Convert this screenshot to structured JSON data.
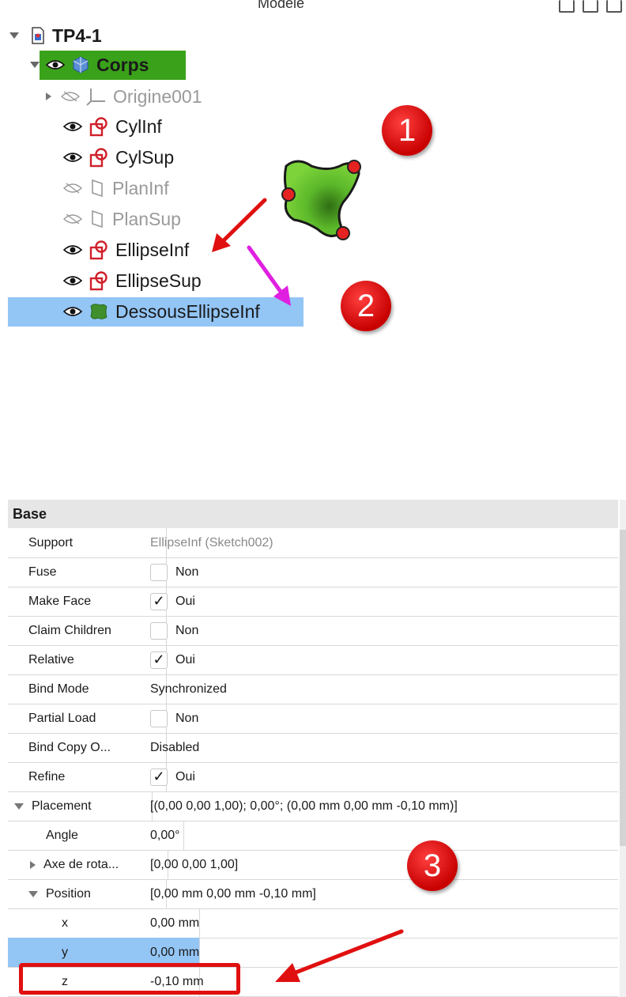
{
  "header": {
    "title": "Modèle"
  },
  "tree": {
    "root": "TP4-1",
    "body": "Corps",
    "items": [
      {
        "label": "Origine001"
      },
      {
        "label": "CylInf"
      },
      {
        "label": "CylSup"
      },
      {
        "label": "PlanInf"
      },
      {
        "label": "PlanSup"
      },
      {
        "label": "EllipseInf"
      },
      {
        "label": "EllipseSup"
      },
      {
        "label": "DessousEllipseInf"
      }
    ]
  },
  "annotations": {
    "badge1": "1",
    "badge2": "2",
    "badge3": "3"
  },
  "properties": {
    "group": "Base",
    "rows": [
      {
        "name": "Support",
        "value": "EllipseInf (Sketch002)"
      },
      {
        "name": "Fuse",
        "value": "Non"
      },
      {
        "name": "Make Face",
        "value": "Oui",
        "check": "✓"
      },
      {
        "name": "Claim Children",
        "value": "Non"
      },
      {
        "name": "Relative",
        "value": "Oui",
        "check": "✓"
      },
      {
        "name": "Bind Mode",
        "value": "Synchronized"
      },
      {
        "name": "Partial Load",
        "value": "Non"
      },
      {
        "name": "Bind Copy O...",
        "value": "Disabled"
      },
      {
        "name": "Refine",
        "value": "Oui",
        "check": "✓"
      },
      {
        "name": "Placement",
        "value": "[(0,00 0,00 1,00); 0,00°; (0,00 mm  0,00 mm  -0,10 mm)]"
      },
      {
        "name": "Angle",
        "value": "0,00°"
      },
      {
        "name": "Axe de rota...",
        "value": "[0,00 0,00 1,00]"
      },
      {
        "name": "Position",
        "value": "[0,00 mm 0,00 mm -0,10 mm]"
      },
      {
        "name": "x",
        "value": "0,00 mm"
      },
      {
        "name": "y",
        "value": "0,00 mm"
      },
      {
        "name": "z",
        "value": "-0,10 mm"
      }
    ]
  },
  "colors": {
    "corps_highlight": "#3aa21a",
    "selection": "#93c5f5",
    "annotation_red": "#e01010",
    "annotation_magenta": "#e020e0"
  }
}
